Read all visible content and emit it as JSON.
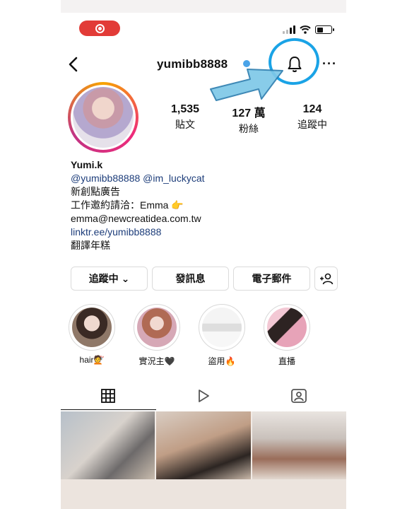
{
  "status_bar": {
    "recording_icon": "record-icon",
    "signal_icon": "cell-signal-icon",
    "wifi_icon": "wifi-icon",
    "battery_icon": "battery-icon"
  },
  "header": {
    "username": "yumibb8888",
    "back_icon": "chevron-left-icon",
    "bell_icon": "bell-icon",
    "more_label": "···"
  },
  "annotation": {
    "arrow_color": "#7ec8e8",
    "circle_color": "#1aa3e6"
  },
  "profile": {
    "stats": [
      {
        "value": "1,535",
        "label": "貼文"
      },
      {
        "value": "127 萬",
        "label": "粉絲"
      },
      {
        "value": "124",
        "label": "追蹤中"
      }
    ],
    "bio": {
      "name": "Yumi.k",
      "mentions": "@yumibb88888 @im_luckycat",
      "line1": "新創點廣告",
      "line2": "工作邀約請洽：Emma 👉",
      "email": "emma@newcreatidea.com.tw",
      "link": "linktr.ee/yumibb8888",
      "line3": "翻譯年糕"
    }
  },
  "actions": {
    "following": "追蹤中 ⌄",
    "message": "發訊息",
    "email": "電子郵件",
    "add_user_icon": "add-user-icon"
  },
  "highlights": [
    {
      "label": "hair💇"
    },
    {
      "label": "實況主🖤"
    },
    {
      "label": "盜用🔥"
    },
    {
      "label": "直播"
    }
  ],
  "tabs": [
    {
      "icon": "grid-icon"
    },
    {
      "icon": "reels-icon"
    },
    {
      "icon": "tagged-icon"
    }
  ]
}
